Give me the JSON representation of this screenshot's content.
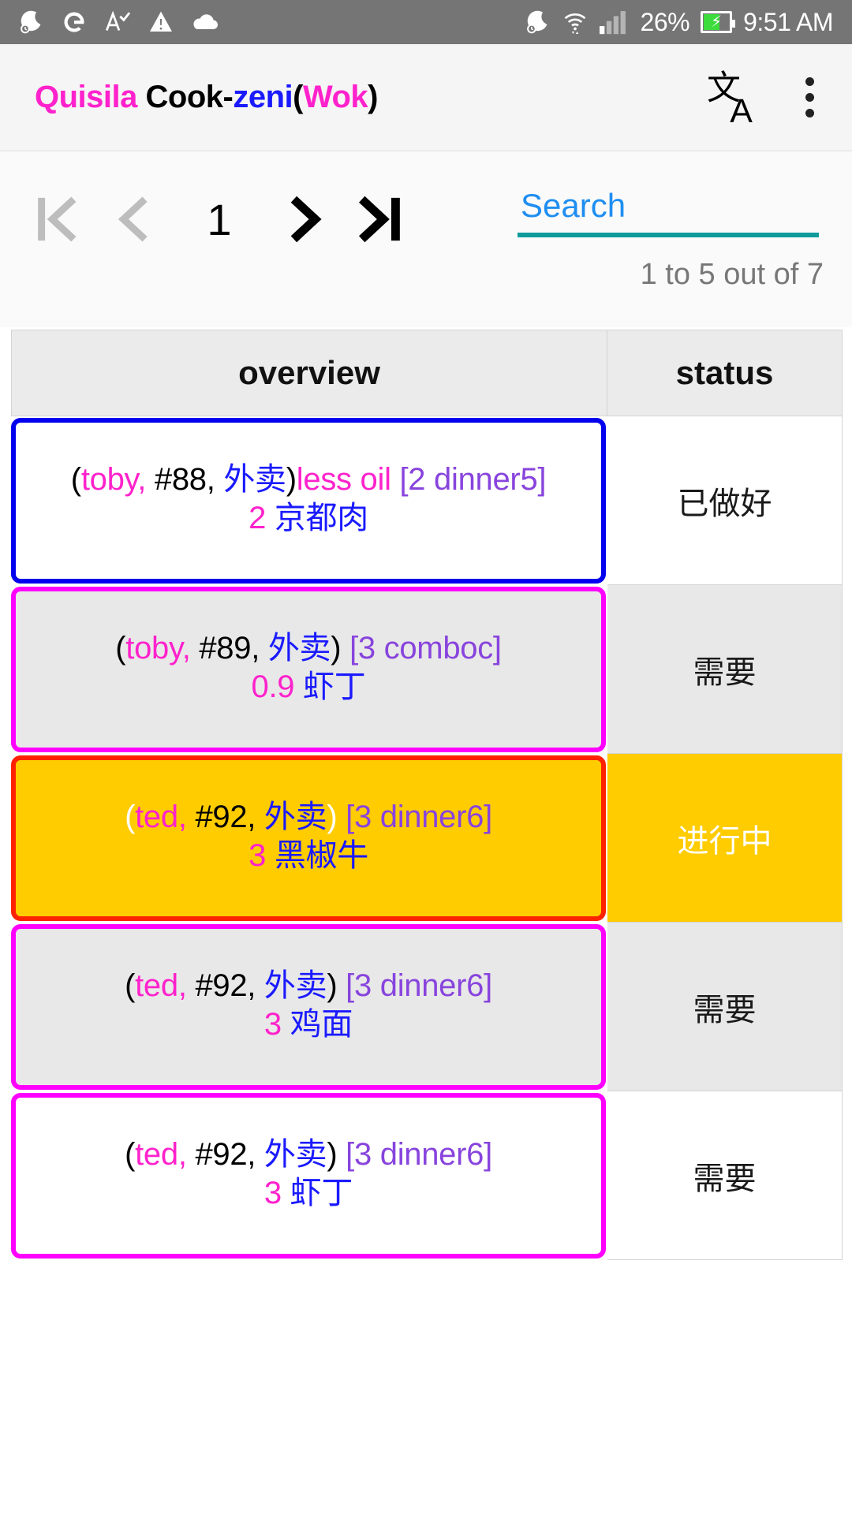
{
  "status_bar": {
    "left_icons": [
      "moon-alarm-icon",
      "google-g-icon",
      "spellcheck-icon",
      "warning-icon",
      "cloud-icon"
    ],
    "right_icons": [
      "moon-alarm-icon",
      "wifi-icon",
      "signal-bars-icon"
    ],
    "battery_percent": "26%",
    "battery_state": "charging",
    "clock": "9:51 AM",
    "bg_color": "#757575"
  },
  "app_bar": {
    "title_parts": [
      {
        "text": "Quisila",
        "color": "#ff22cc"
      },
      {
        "text": " Cook-",
        "color": "#000000"
      },
      {
        "text": "zeni",
        "color": "#1a1aff"
      },
      {
        "text": "(",
        "color": "#000000"
      },
      {
        "text": "Wok",
        "color": "#ff22cc"
      },
      {
        "text": ")",
        "color": "#000000"
      }
    ],
    "title_plain": "Quisila Cook-zeni(Wok)",
    "translate_label": "文A",
    "overflow_label": "more-options"
  },
  "toolbar": {
    "pagination": {
      "first_label": "|<",
      "prev_label": "<",
      "current_page": "1",
      "next_label": ">",
      "last_label": ">|",
      "first_enabled": false,
      "prev_enabled": false,
      "next_enabled": true,
      "last_enabled": true,
      "disabled_color": "#bdbdbd",
      "enabled_color": "#000000"
    },
    "search": {
      "value": "",
      "placeholder": "Search",
      "placeholder_color": "#1f8ef1",
      "underline_color": "#0f9b9b"
    },
    "range_label": "1 to 5 out of 7"
  },
  "table": {
    "columns": [
      {
        "key": "overview",
        "label": "overview"
      },
      {
        "key": "status",
        "label": "status"
      }
    ],
    "rows": [
      {
        "id": "row-1",
        "border_color": "#0000ee",
        "bg_color": "#ffffff",
        "paren_color": "#000000",
        "line1": [
          {
            "text": "(",
            "color": "#000000"
          },
          {
            "text": "toby,",
            "color": "#ff22cc"
          },
          {
            "text": " #88,",
            "color": "#000000"
          },
          {
            "text": " 外卖",
            "color": "#1a1aff"
          },
          {
            "text": ")",
            "color": "#000000"
          },
          {
            "text": "less oil",
            "color": "#ff22cc"
          },
          {
            "text": " [2 dinner5]",
            "color": "#8844dd"
          }
        ],
        "line1_plain": "(toby, #88, 外卖)less oil [2 dinner5]",
        "line2": [
          {
            "text": "2",
            "color": "#ff22cc"
          },
          {
            "text": " 京都肉",
            "color": "#1a1aff"
          }
        ],
        "line2_plain": "2 京都肉",
        "status": "已做好",
        "status_bg": "#ffffff",
        "status_color": "#1a1a1a"
      },
      {
        "id": "row-2",
        "border_color": "#ff00ff",
        "bg_color": "#e8e8e8",
        "paren_color": "#000000",
        "line1": [
          {
            "text": "(",
            "color": "#000000"
          },
          {
            "text": "toby,",
            "color": "#ff22cc"
          },
          {
            "text": " #89,",
            "color": "#000000"
          },
          {
            "text": " 外卖",
            "color": "#1a1aff"
          },
          {
            "text": ")",
            "color": "#000000"
          },
          {
            "text": " [3 comboc]",
            "color": "#8844dd"
          }
        ],
        "line1_plain": "(toby, #89, 外卖) [3 comboc]",
        "line2": [
          {
            "text": "0.9",
            "color": "#ff22cc"
          },
          {
            "text": " 虾丁",
            "color": "#1a1aff"
          }
        ],
        "line2_plain": "0.9 虾丁",
        "status": "需要",
        "status_bg": "#e8e8e8",
        "status_color": "#1a1a1a"
      },
      {
        "id": "row-3",
        "border_color": "#ff2200",
        "bg_color": "#ffcc00",
        "paren_color": "#ffffff",
        "line1": [
          {
            "text": "(",
            "color": "#ffffff"
          },
          {
            "text": "ted,",
            "color": "#ff22cc"
          },
          {
            "text": " #92,",
            "color": "#000000"
          },
          {
            "text": " 外卖",
            "color": "#1a1aff"
          },
          {
            "text": ")",
            "color": "#ffffff"
          },
          {
            "text": " [3 dinner6]",
            "color": "#8844dd"
          }
        ],
        "line1_plain": "(ted, #92, 外卖) [3 dinner6]",
        "line2": [
          {
            "text": "3",
            "color": "#ff22cc"
          },
          {
            "text": " 黑椒牛",
            "color": "#1a1aff"
          }
        ],
        "line2_plain": "3 黑椒牛",
        "status": "进行中",
        "status_bg": "#ffcc00",
        "status_color": "#ffffff"
      },
      {
        "id": "row-4",
        "border_color": "#ff00ff",
        "bg_color": "#e8e8e8",
        "paren_color": "#000000",
        "line1": [
          {
            "text": "(",
            "color": "#000000"
          },
          {
            "text": "ted,",
            "color": "#ff22cc"
          },
          {
            "text": " #92,",
            "color": "#000000"
          },
          {
            "text": " 外卖",
            "color": "#1a1aff"
          },
          {
            "text": ")",
            "color": "#000000"
          },
          {
            "text": " [3 dinner6]",
            "color": "#8844dd"
          }
        ],
        "line1_plain": "(ted, #92, 外卖) [3 dinner6]",
        "line2": [
          {
            "text": "3",
            "color": "#ff22cc"
          },
          {
            "text": " 鸡面",
            "color": "#1a1aff"
          }
        ],
        "line2_plain": "3 鸡面",
        "status": "需要",
        "status_bg": "#e8e8e8",
        "status_color": "#1a1a1a"
      },
      {
        "id": "row-5",
        "border_color": "#ff00ff",
        "bg_color": "#ffffff",
        "paren_color": "#000000",
        "line1": [
          {
            "text": "(",
            "color": "#000000"
          },
          {
            "text": "ted,",
            "color": "#ff22cc"
          },
          {
            "text": " #92,",
            "color": "#000000"
          },
          {
            "text": " 外卖",
            "color": "#1a1aff"
          },
          {
            "text": ")",
            "color": "#000000"
          },
          {
            "text": " [3 dinner6]",
            "color": "#8844dd"
          }
        ],
        "line1_plain": "(ted, #92, 外卖) [3 dinner6]",
        "line2": [
          {
            "text": "3",
            "color": "#ff22cc"
          },
          {
            "text": " 虾丁",
            "color": "#1a1aff"
          }
        ],
        "line2_plain": "3 虾丁",
        "status": "需要",
        "status_bg": "#ffffff",
        "status_color": "#1a1a1a"
      }
    ]
  }
}
